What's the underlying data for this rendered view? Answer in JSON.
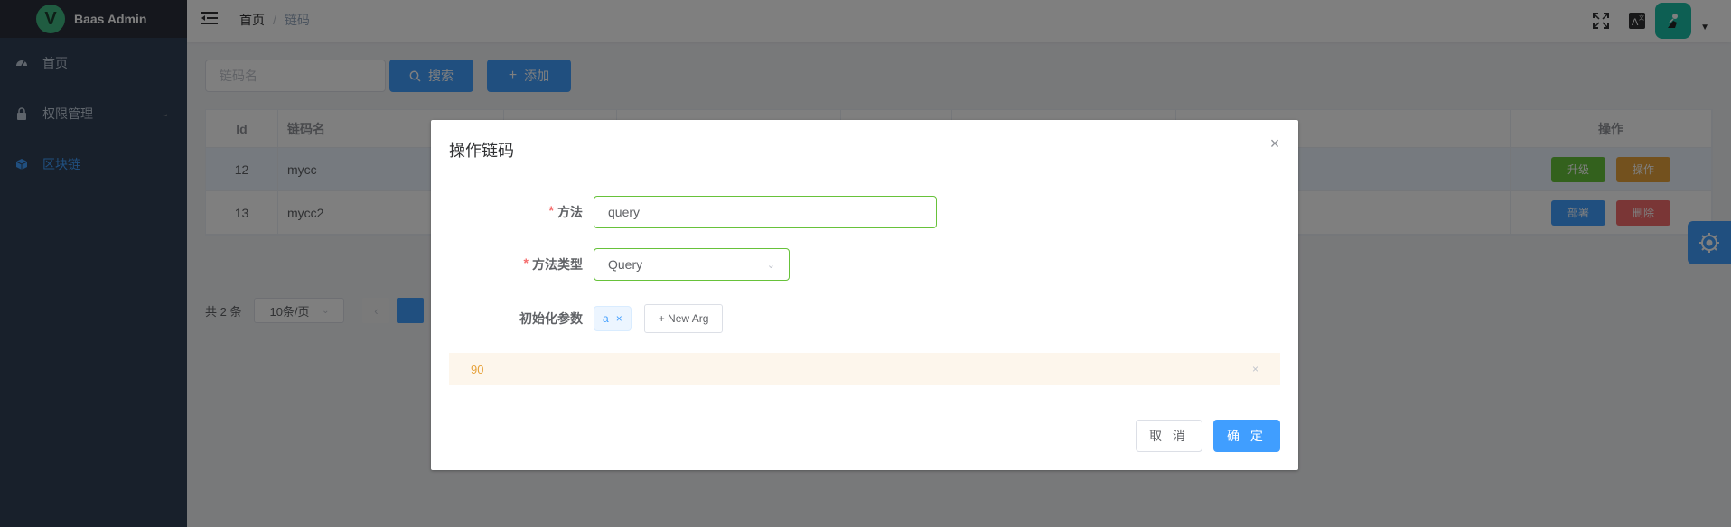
{
  "app": {
    "title": "Baas Admin",
    "logo_letter": "V"
  },
  "sidebar": {
    "items": [
      {
        "label": "首页",
        "icon": "dashboard-icon",
        "active": false
      },
      {
        "label": "权限管理",
        "icon": "lock-icon",
        "active": false,
        "has_children": true
      },
      {
        "label": "区块链",
        "icon": "cube-icon",
        "active": true
      }
    ]
  },
  "navbar": {
    "breadcrumb": {
      "home": "首页",
      "separator": "/",
      "current": "链码"
    },
    "icons": [
      "fullscreen-icon",
      "translate-icon"
    ]
  },
  "filter": {
    "placeholder": "链码名",
    "search_label": "搜索",
    "add_label": "添加"
  },
  "table": {
    "headers": {
      "id": "Id",
      "name": "链码名",
      "ops": "操作"
    },
    "rows": [
      {
        "id": "12",
        "name": "mycc",
        "actions": [
          {
            "label": "升级",
            "color": "#67c23a"
          },
          {
            "label": "操作",
            "color": "#e6a23c"
          }
        ]
      },
      {
        "id": "13",
        "name": "mycc2",
        "actions": [
          {
            "label": "部署",
            "color": "#409eff"
          },
          {
            "label": "删除",
            "color": "#f56c6c"
          }
        ]
      }
    ]
  },
  "pagination": {
    "total_text": "共 2 条",
    "page_size": "10条/页",
    "prev_symbol": "‹"
  },
  "dialog": {
    "title": "操作链码",
    "method_label": "方法",
    "method_value": "query",
    "type_label": "方法类型",
    "type_value": "Query",
    "args_label": "初始化参数",
    "tags": [
      {
        "label": "a"
      }
    ],
    "new_arg_label": "+ New Arg",
    "alert_text": "90",
    "cancel_label": "取 消",
    "confirm_label": "确 定"
  },
  "colors": {
    "primary": "#409eff",
    "sidebar_bg": "#304156",
    "success": "#67c23a",
    "warning": "#e6a23c",
    "danger": "#f56c6c"
  }
}
